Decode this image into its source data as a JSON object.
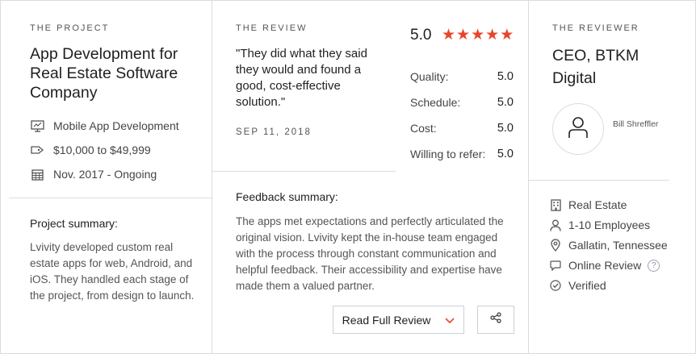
{
  "project": {
    "label": "THE PROJECT",
    "title": "App Development for Real Estate Software Company",
    "service": "Mobile App Development",
    "budget": "$10,000 to $49,999",
    "timeline": "Nov. 2017 - Ongoing",
    "summary_heading": "Project summary:",
    "summary": "Lvivity developed custom real estate apps for web, Android, and iOS. They handled each stage of the project, from design to launch."
  },
  "review": {
    "label": "THE REVIEW",
    "quote": "\"They did what they said they would and found a good, cost-effective solution.\"",
    "date": "SEP 11, 2018",
    "overall": "5.0",
    "star_count": 5,
    "scores": [
      {
        "label": "Quality:",
        "value": "5.0"
      },
      {
        "label": "Schedule:",
        "value": "5.0"
      },
      {
        "label": "Cost:",
        "value": "5.0"
      },
      {
        "label": "Willing to refer:",
        "value": "5.0"
      }
    ],
    "feedback_heading": "Feedback summary:",
    "feedback": "The apps met expectations and perfectly articulated the original vision. Lvivity kept the in-house team engaged with the process through constant communication and helpful feedback. Their accessibility and expertise have made them a valued partner.",
    "read_button": "Read Full Review"
  },
  "reviewer": {
    "label": "THE REVIEWER",
    "title": "CEO, BTKM Digital",
    "name": "Bill Shreffler",
    "industry": "Real Estate",
    "size": "1-10 Employees",
    "location": "Gallatin, Tennessee",
    "review_type": "Online Review",
    "help_mark": "?",
    "status": "Verified"
  },
  "colors": {
    "star": "#e8452c",
    "border": "#d8dde3",
    "chevron": "#e8452c"
  },
  "icons": [
    "monitor-icon",
    "price-tag-icon",
    "calendar-icon",
    "building-icon",
    "user-icon",
    "location-pin-icon",
    "chat-bubble-icon",
    "check-circle-icon",
    "share-icon",
    "chevron-down-icon"
  ]
}
